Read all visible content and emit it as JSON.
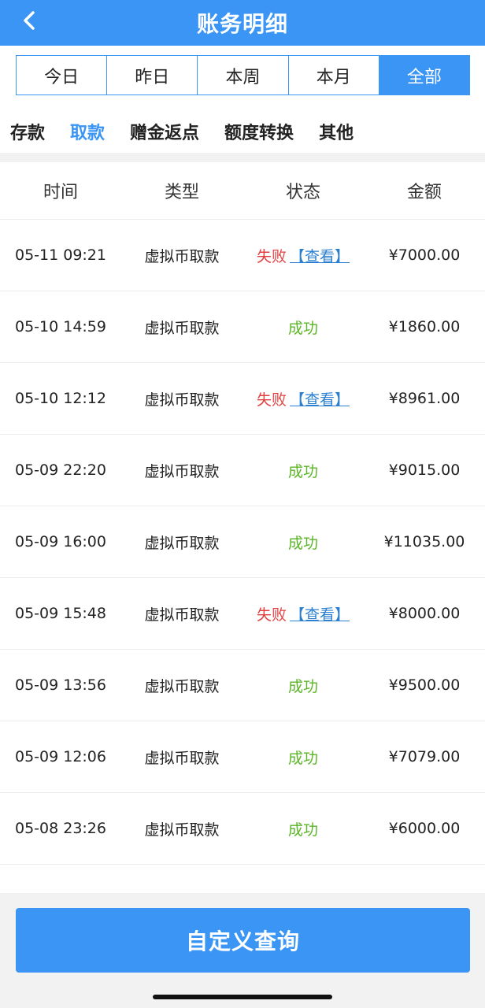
{
  "header": {
    "title": "账务明细"
  },
  "period_tabs": [
    {
      "label": "今日",
      "active": false
    },
    {
      "label": "昨日",
      "active": false
    },
    {
      "label": "本周",
      "active": false
    },
    {
      "label": "本月",
      "active": false
    },
    {
      "label": "全部",
      "active": true
    }
  ],
  "category_tabs": [
    {
      "label": "存款",
      "active": false
    },
    {
      "label": "取款",
      "active": true
    },
    {
      "label": "赠金返点",
      "active": false
    },
    {
      "label": "额度转换",
      "active": false
    },
    {
      "label": "其他",
      "active": false
    }
  ],
  "table": {
    "columns": [
      "时间",
      "类型",
      "状态",
      "金额"
    ],
    "rows": [
      {
        "time": "05-11 09:21",
        "type": "虚拟币取款",
        "status": "失败",
        "status_kind": "fail",
        "link": "【查看】",
        "amount": "¥7000.00"
      },
      {
        "time": "05-10 14:59",
        "type": "虚拟币取款",
        "status": "成功",
        "status_kind": "ok",
        "link": "",
        "amount": "¥1860.00"
      },
      {
        "time": "05-10 12:12",
        "type": "虚拟币取款",
        "status": "失败",
        "status_kind": "fail",
        "link": "【查看】",
        "amount": "¥8961.00"
      },
      {
        "time": "05-09 22:20",
        "type": "虚拟币取款",
        "status": "成功",
        "status_kind": "ok",
        "link": "",
        "amount": "¥9015.00"
      },
      {
        "time": "05-09 16:00",
        "type": "虚拟币取款",
        "status": "成功",
        "status_kind": "ok",
        "link": "",
        "amount": "¥11035.00"
      },
      {
        "time": "05-09 15:48",
        "type": "虚拟币取款",
        "status": "失败",
        "status_kind": "fail",
        "link": "【查看】",
        "amount": "¥8000.00"
      },
      {
        "time": "05-09 13:56",
        "type": "虚拟币取款",
        "status": "成功",
        "status_kind": "ok",
        "link": "",
        "amount": "¥9500.00"
      },
      {
        "time": "05-09 12:06",
        "type": "虚拟币取款",
        "status": "成功",
        "status_kind": "ok",
        "link": "",
        "amount": "¥7079.00"
      },
      {
        "time": "05-08 23:26",
        "type": "虚拟币取款",
        "status": "成功",
        "status_kind": "ok",
        "link": "",
        "amount": "¥6000.00"
      }
    ]
  },
  "query_button": {
    "label": "自定义查询"
  },
  "colors": {
    "accent": "#3a95f4",
    "fail": "#e24040",
    "success": "#5bb527",
    "link": "#2a7fd1"
  }
}
